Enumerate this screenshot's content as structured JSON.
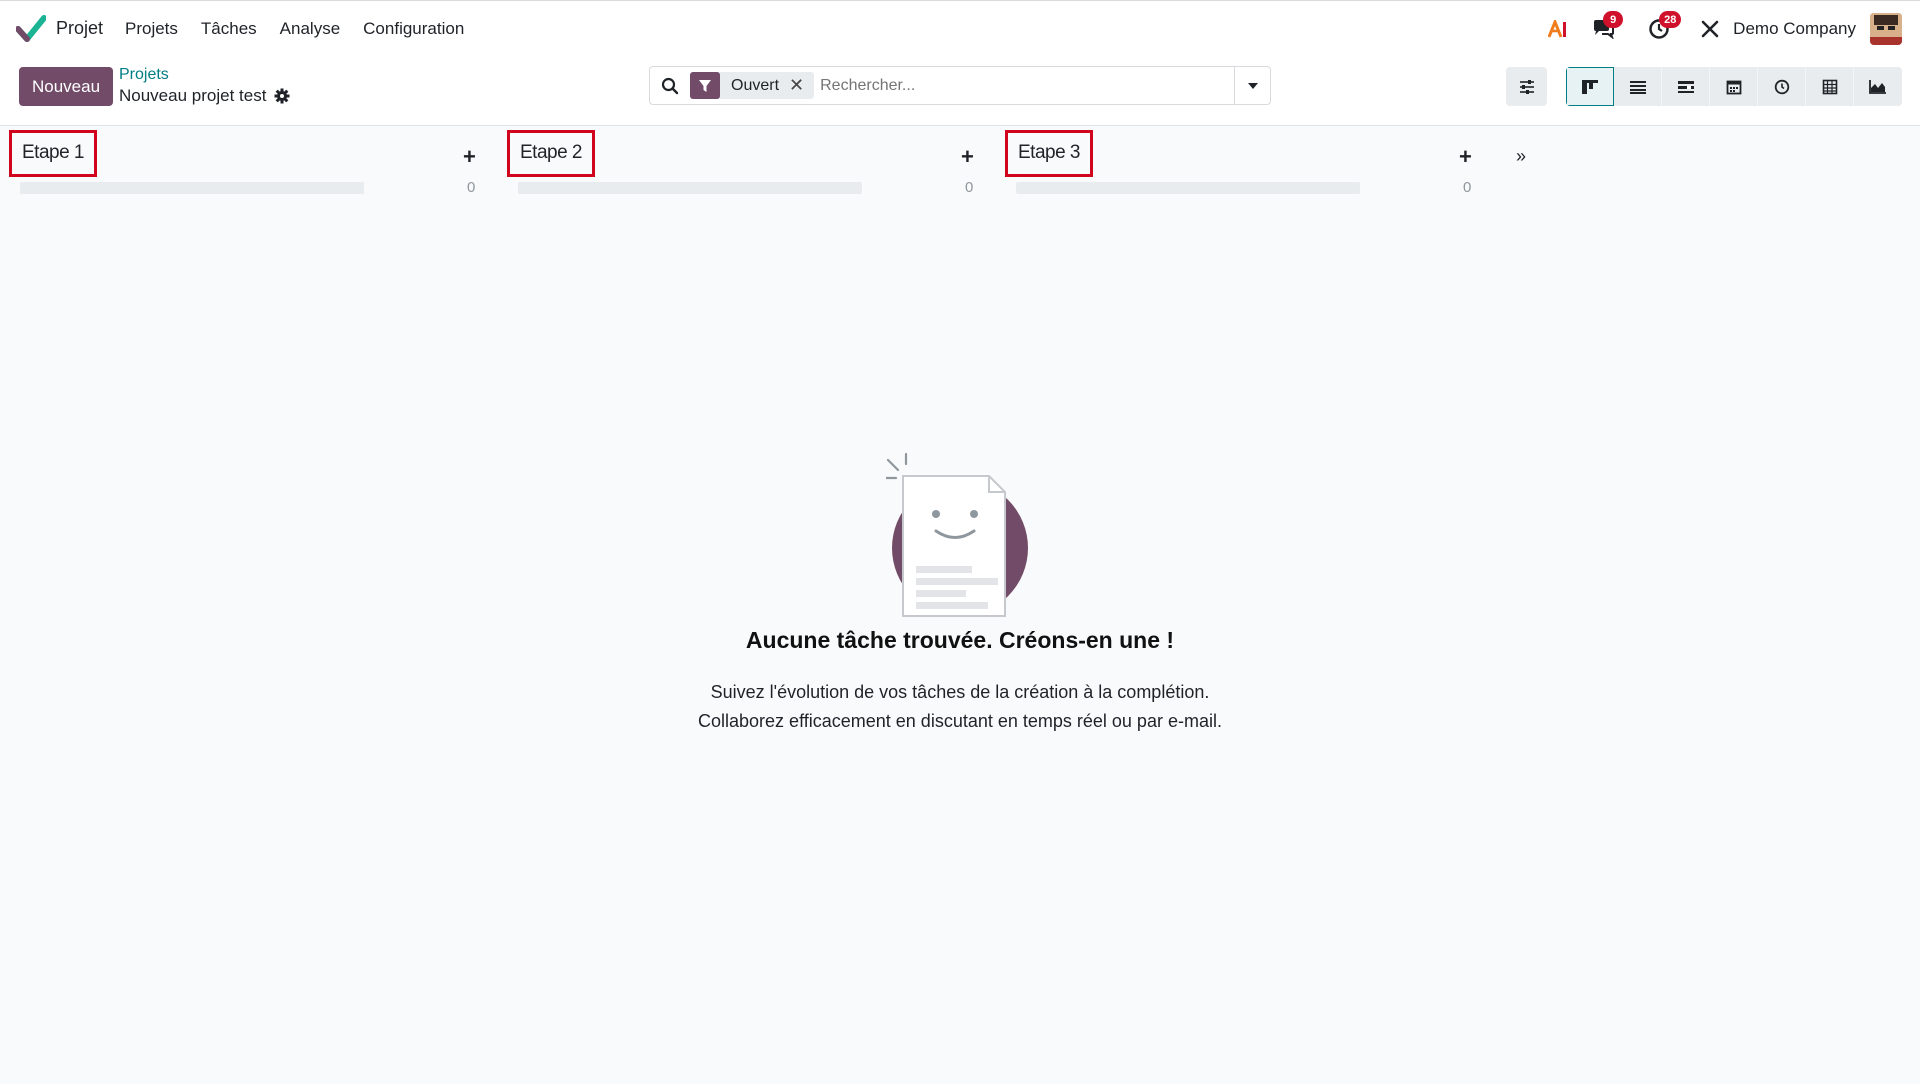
{
  "nav": {
    "app_name": "Projet",
    "menu": [
      "Projets",
      "Tâches",
      "Analyse",
      "Configuration"
    ],
    "messages_count": "9",
    "activities_count": "28",
    "company": "Demo Company"
  },
  "control": {
    "new_button": "Nouveau",
    "breadcrumb_parent": "Projets",
    "project_name": "Nouveau projet test",
    "filter_facet": "Ouvert",
    "search_placeholder": "Rechercher..."
  },
  "views": [
    "kanban",
    "list",
    "gantt",
    "calendar",
    "activity",
    "pivot",
    "graph"
  ],
  "stages": [
    {
      "name": "Etape 1",
      "count": "0"
    },
    {
      "name": "Etape 2",
      "count": "0"
    },
    {
      "name": "Etape 3",
      "count": "0"
    }
  ],
  "empty": {
    "title": "Aucune tâche trouvée. Créons-en une !",
    "line1": "Suivez l'évolution de vos tâches de la création à la complétion.",
    "line2": "Collaborez efficacement en discutant en temps réel ou par e-mail."
  },
  "colors": {
    "brand": "#714b67",
    "accent": "#017e84",
    "badge": "#d0112b",
    "highlight_border": "#d0041c"
  }
}
